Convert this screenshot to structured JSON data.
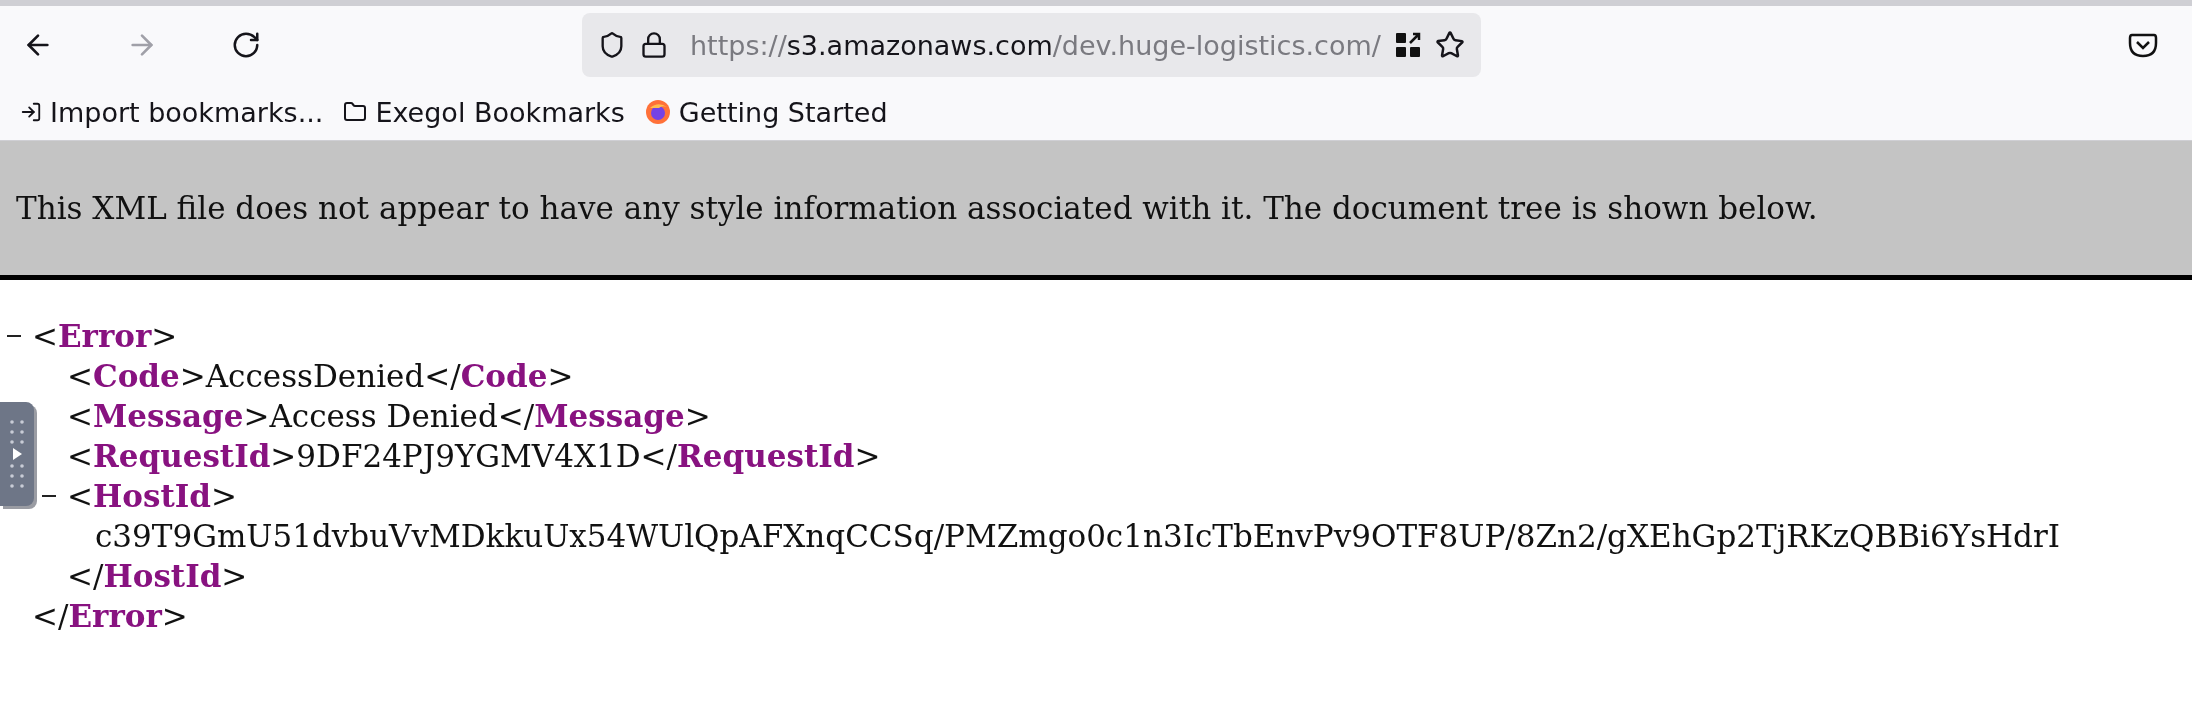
{
  "navigation": {
    "back": {
      "disabled": false
    },
    "forward": {
      "disabled": true
    }
  },
  "address_bar": {
    "scheme": "https://",
    "host": "s3.amazonaws.com",
    "path": "/dev.huge-logistics.com/"
  },
  "bookmarks": [
    {
      "kind": "import",
      "label": "Import bookmarks..."
    },
    {
      "kind": "folder",
      "label": "Exegol Bookmarks"
    },
    {
      "kind": "site",
      "label": "Getting Started"
    }
  ],
  "banner": "This XML file does not appear to have any style information associated with it. The document tree is shown below.",
  "xml_tree": {
    "open": "<**Error**>",
    "expanded": true,
    "close": "</**Error**>",
    "children": [
      {
        "line": "<**Code**>AccessDenied</**Code**>"
      },
      {
        "line": "<**Message**>Access Denied</**Message**>"
      },
      {
        "line": "<**RequestId**>9DF24PJ9YGMV4X1D</**RequestId**>"
      },
      {
        "open": "<**HostId**>",
        "expanded": true,
        "text": "c39T9GmU51dvbuVvMDkkuUx54WUlQpAFXnqCCSq/PMZmgo0c1n3IcTbEnvPv9OTF8UP/8Zn2/gXEhGp2TjRKzQBBi6YsHdrI",
        "close": "</**HostId**>"
      }
    ]
  }
}
